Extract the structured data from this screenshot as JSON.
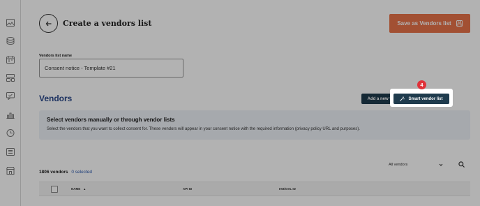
{
  "sidebar": {
    "icons": [
      "images-icon",
      "database-icon",
      "calendar-icon",
      "layout-icon",
      "chat-icon",
      "chart-icon",
      "clock-icon",
      "list-icon",
      "store-icon"
    ]
  },
  "header": {
    "title": "Create a vendors list",
    "save_label": "Save as Vendors list"
  },
  "form": {
    "name_label": "Vendors list name",
    "name_value": "Consent notice - Template #21"
  },
  "vendors": {
    "title": "Vendors",
    "add_label": "Add a new vendor",
    "smart_label": "Smart vendor list",
    "step": "4"
  },
  "info": {
    "title": "Select vendors manually or through vendor lists",
    "text": "Select the vendors that you want to collect consent for. These vendors will appear in your consent notice with the required information (privacy policy URL and purposes)."
  },
  "filter": {
    "selected": "All vendors"
  },
  "counts": {
    "total": "1806 vendors",
    "selected": "0 selected"
  },
  "table": {
    "columns": [
      "NAME",
      "API ID",
      "IAB/GVL ID"
    ]
  },
  "colors": {
    "accent": "#e8734a",
    "primary": "#1f3b4d",
    "heading": "#2c4a8c",
    "badge": "#e0323a"
  }
}
